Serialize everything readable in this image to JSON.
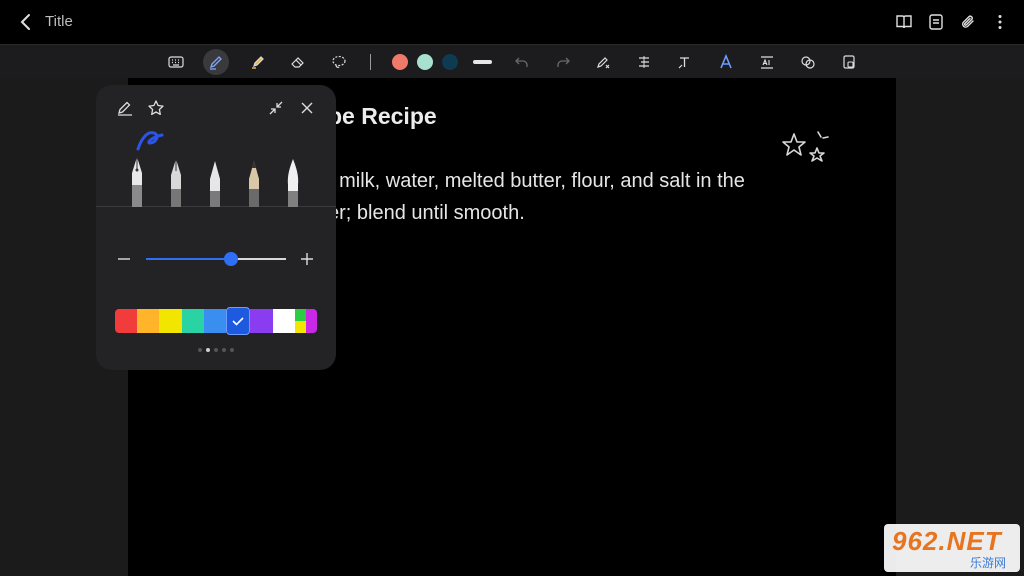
{
  "header": {
    "title": "Title"
  },
  "toolbar": {
    "colors": [
      "#f07a6a",
      "#a8e0cf",
      "#0e3a52"
    ]
  },
  "document": {
    "title": "pe Recipe",
    "lines": [
      ", milk, water, melted butter, flour, and salt in the",
      "er; blend until smooth."
    ]
  },
  "pen_panel": {
    "size_fraction": 0.61,
    "palette": [
      "#f23c3c",
      "#ffb42a",
      "#f2e500",
      "#2ad3a4",
      "#3a8ef0",
      "#1e5ae0",
      "#8a3cf0",
      "#ffffff",
      "multicolor"
    ],
    "selected_index": 5,
    "page_dots": 5,
    "active_dot": 1
  },
  "watermark": {
    "big": "962.NET",
    "small": "乐游网"
  },
  "icons": {
    "back": "back-arrow-icon",
    "top": [
      "book-icon",
      "note-icon",
      "paperclip-icon",
      "more-vert-icon"
    ],
    "toolbar": [
      "keyboard-icon",
      "pen-icon",
      "highlighter-icon",
      "eraser-icon",
      "lasso-icon",
      "undo-icon",
      "redo-icon",
      "pen-settings-icon",
      "align-icon",
      "text-style-icon",
      "font-color-icon",
      "text-convert-icon",
      "shapes-icon",
      "lock-icon"
    ]
  }
}
